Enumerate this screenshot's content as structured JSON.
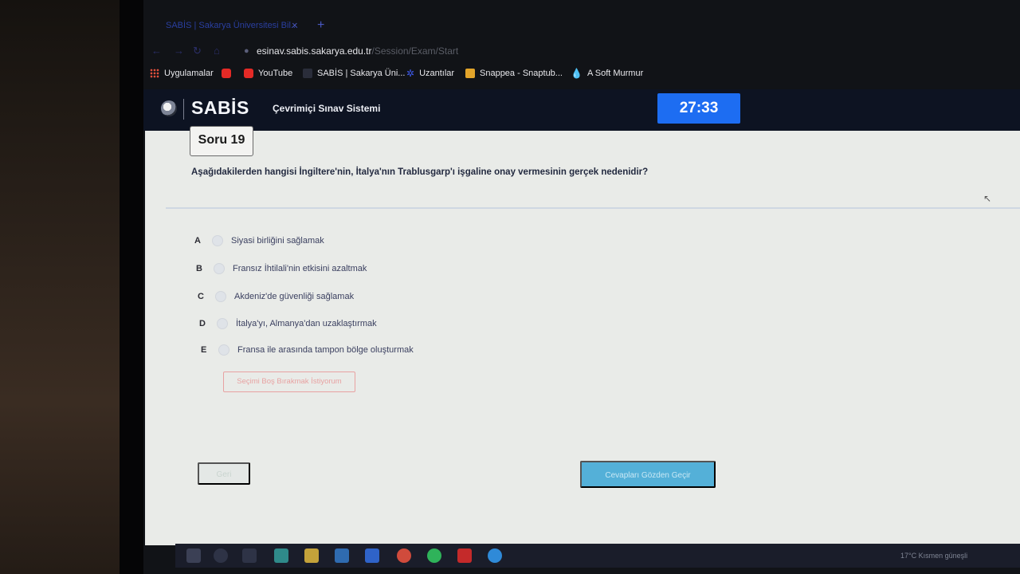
{
  "browser": {
    "tab_title": "SABİS | Sakarya Üniversitesi Bil...",
    "tab_close": "×",
    "tab_new": "+",
    "url_host": "esinav.sabis.sakarya.edu.tr",
    "url_path": "/Session/Exam/Start",
    "bookmarks": [
      {
        "label": "Uygulamalar",
        "icon": "apps-grid-icon"
      },
      {
        "label": "",
        "icon": "youtube-icon"
      },
      {
        "label": "YouTube",
        "icon": "youtube-icon"
      },
      {
        "label": "SABİS | Sakarya Üni...",
        "icon": ""
      },
      {
        "label": "Uzantılar",
        "icon": "puzzle-icon"
      },
      {
        "label": "Snappea - Snaptub...",
        "icon": "snappea-icon"
      },
      {
        "label": "A Soft Murmur",
        "icon": "drop-icon"
      }
    ]
  },
  "app": {
    "logo": "SABİS",
    "subtitle": "Çevrimiçi Sınav Sistemi",
    "timer": "27:33"
  },
  "question": {
    "badge": "Soru 19",
    "text": "Aşağıdakilerden hangisi İngiltere'nin, İtalya'nın Trablusgarp'ı işgaline onay vermesinin gerçek nedenidir?",
    "options": [
      {
        "letter": "A",
        "text": "Siyasi birliğini sağlamak"
      },
      {
        "letter": "B",
        "text": "Fransız İhtilali'nin etkisini azaltmak"
      },
      {
        "letter": "C",
        "text": "Akdeniz'de güvenliği sağlamak"
      },
      {
        "letter": "D",
        "text": "İtalya'yı, Almanya'dan uzaklaştırmak"
      },
      {
        "letter": "E",
        "text": "Fransa ile arasında tampon bölge oluşturmak"
      }
    ],
    "skip_label": "Seçimi Boş Bırakmak İstiyorum",
    "back_label": "Geri",
    "next_label": "Cevapları Gözden Geçir"
  },
  "taskbar": {
    "weather": "17°C  Kısmen güneşli"
  },
  "colors": {
    "timer_bg": "#1d6df2",
    "appbar_bg": "#0d1322",
    "next_btn": "#54b0d8",
    "skip_border": "#e8a2a2"
  }
}
